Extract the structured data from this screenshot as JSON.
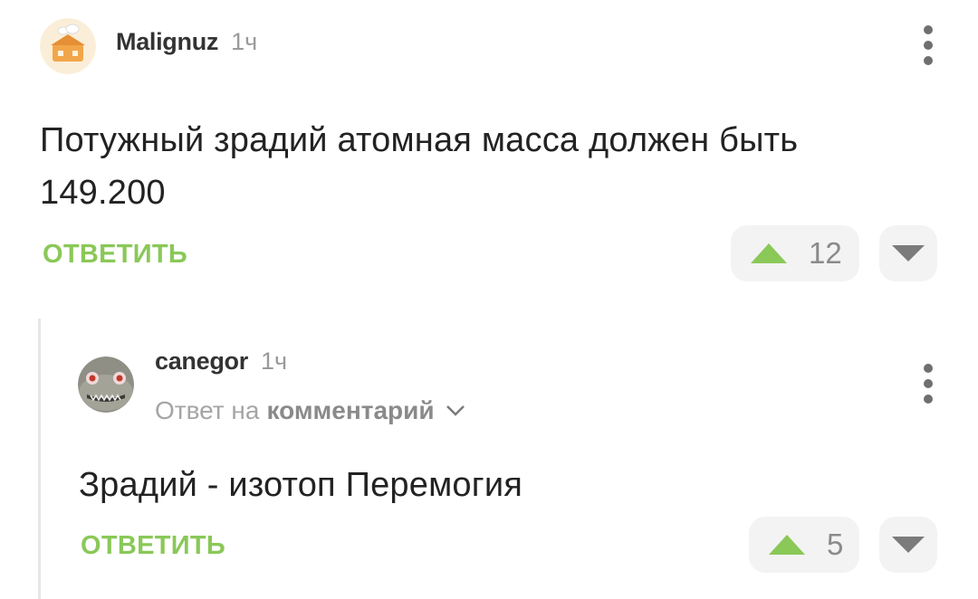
{
  "comment1": {
    "username": "Malignuz",
    "time": "1ч",
    "text_line1": "Потужный зрадий атомная масса должен быть",
    "text_line2": "149.200",
    "reply_label": "ОТВЕТИТЬ",
    "votes": "12"
  },
  "comment2": {
    "username": "canegor",
    "time": "1ч",
    "reply_prefix": "Ответ на",
    "reply_target": "комментарий",
    "text": "Зрадий - изотоп Перемогия",
    "reply_label": "ОТВЕТИТЬ",
    "votes": "5"
  },
  "colors": {
    "accent_green": "#8ac858",
    "vote_bg": "#f3f3f3",
    "muted_text": "#9a9a9a"
  },
  "icons": {
    "upvote": "triangle-up-icon",
    "downvote": "triangle-down-icon",
    "menu": "kebab-menu-icon",
    "expand": "chevron-down-icon"
  }
}
